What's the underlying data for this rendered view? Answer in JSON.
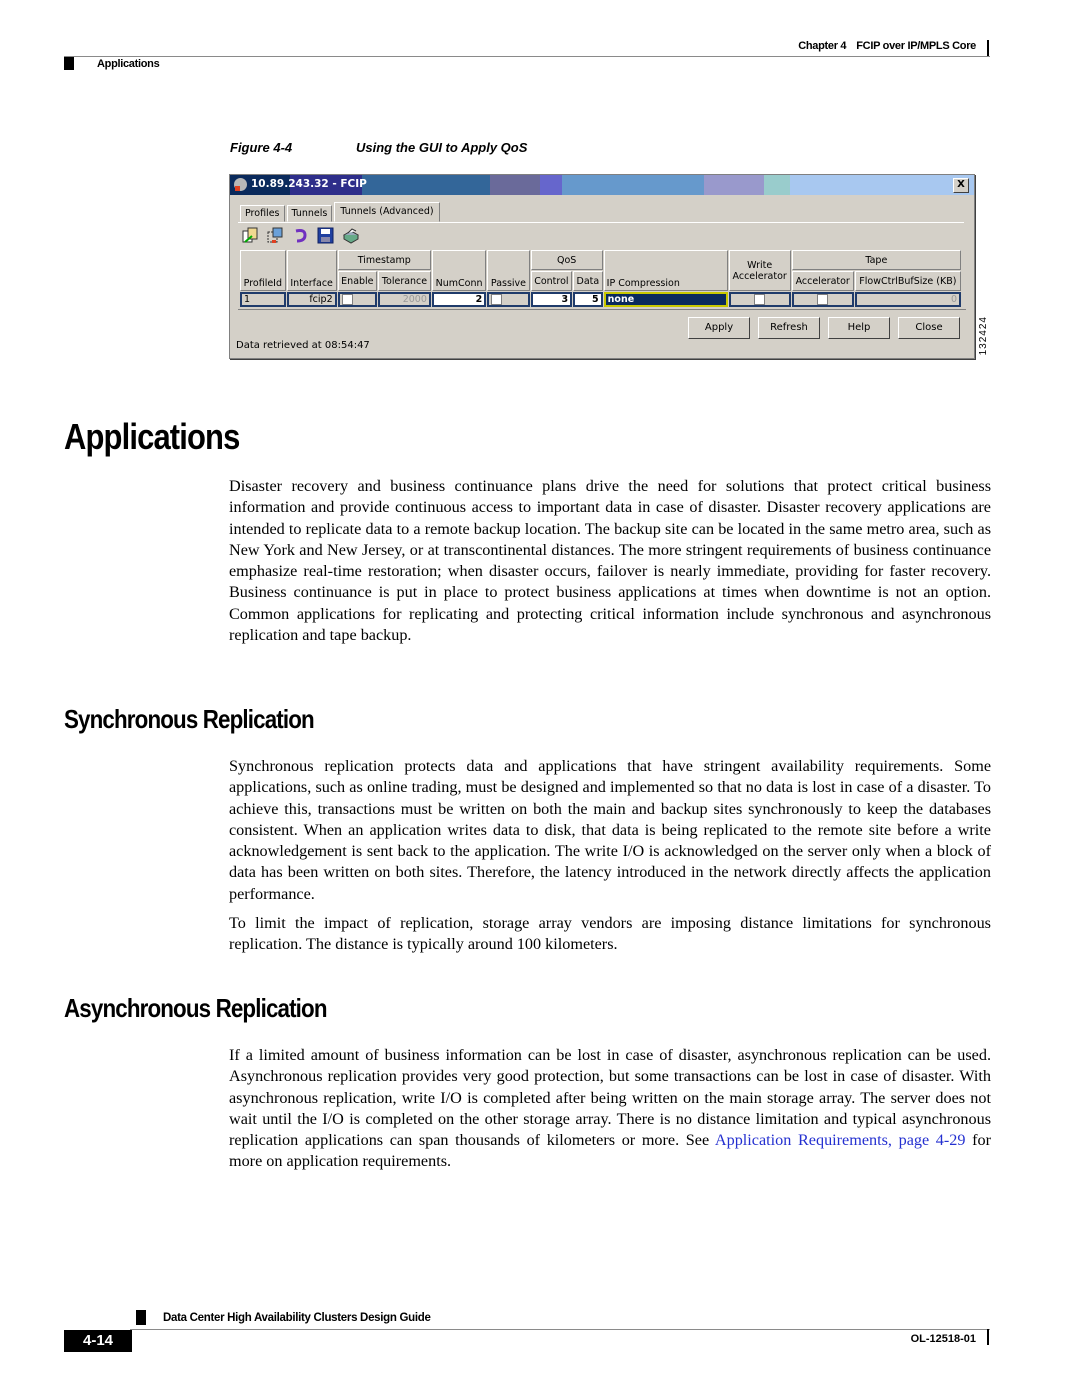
{
  "header": {
    "chapter_label": "Chapter 4",
    "chapter_title": "FCIP over IP/MPLS Core",
    "section": "Applications"
  },
  "figure": {
    "number": "Figure 4-4",
    "title": "Using the GUI to Apply QoS",
    "id": "132424",
    "window": {
      "title": "10.89.243.32 - FCIP",
      "close_glyph": "X",
      "tabs": [
        {
          "label": "Profiles",
          "active": false
        },
        {
          "label": "Tunnels",
          "active": false
        },
        {
          "label": "Tunnels (Advanced)",
          "active": true
        }
      ],
      "toolbar_icons": [
        "copy-config-icon",
        "paste-config-icon",
        "undo-icon",
        "save-icon",
        "print-icon"
      ],
      "group_headers": {
        "timestamp": "Timestamp",
        "qos": "QoS",
        "write": "Write",
        "tape": "Tape"
      },
      "columns": [
        "ProfileId",
        "Interface",
        "Enable",
        "Tolerance",
        "NumConn",
        "Passive",
        "Control",
        "Data",
        "IP Compression",
        "Accelerator",
        "Accelerator",
        "FlowCtrlBufSize (KB)"
      ],
      "row": {
        "profile_id": "1",
        "interface": "fcip2",
        "enable": false,
        "tolerance": "2000",
        "num_conn": "2",
        "passive": false,
        "qos_control": "3",
        "qos_data": "5",
        "ip_compression": "none",
        "write_accelerator": false,
        "tape_accelerator": false,
        "flow_ctrl_buf_size": "0"
      },
      "buttons": {
        "apply": "Apply",
        "refresh": "Refresh",
        "help": "Help",
        "close": "Close"
      },
      "status": "Data retrieved at 08:54:47"
    }
  },
  "sections": {
    "applications": {
      "title": "Applications",
      "body": "Disaster recovery and business continuance plans drive the need for solutions that protect critical business information and provide continuous access to important data in case of disaster. Disaster recovery applications are intended to replicate data to a remote backup location. The backup site can be located in the same metro area, such as New York and New Jersey, or at transcontinental distances. The more stringent requirements of business continuance emphasize real-time restoration; when disaster occurs, failover is nearly immediate, providing for faster recovery. Business continuance is put in place to protect business applications at times when downtime is not an option. Common applications for replicating and protecting critical information include synchronous and asynchronous replication and tape backup."
    },
    "synchronous": {
      "title": "Synchronous Replication",
      "body1": "Synchronous replication protects data and applications that have stringent availability requirements. Some applications, such as online trading, must be designed and implemented so that no data is lost in case of a disaster. To achieve this, transactions must be written on both the main and backup sites synchronously to keep the databases consistent. When an application writes data to disk, that data is being replicated to the remote site before a write acknowledgement is sent back to the application. The write I/O is acknowledged on the server only when a block of data has been written on both sites. Therefore, the latency introduced in the network directly affects the application performance.",
      "body2": "To limit the impact of replication, storage array vendors are imposing distance limitations for synchronous replication. The distance is typically around 100 kilometers."
    },
    "asynchronous": {
      "title": "Asynchronous Replication",
      "body_before_link": "If a limited amount of business information can be lost in case of disaster, asynchronous replication can be used. Asynchronous replication provides very good protection, but some transactions can be lost in case of disaster. With asynchronous replication, write I/O is completed after being written on the main storage array. The server does not wait until the I/O is completed on the other storage array. There is no distance limitation and typical asynchronous replication applications can span thousands of kilometers or more. See ",
      "link_text": "Application Requirements, page 4-29",
      "body_after_link": " for more on application requirements."
    }
  },
  "footer": {
    "guide_title": "Data Center High Availability Clusters Design Guide",
    "page_number": "4-14",
    "doc_number": "OL-12518-01"
  },
  "colors": {
    "link": "#2430d0",
    "selected_cell": "#0a2a5c",
    "window_bg": "#d4d0c8"
  }
}
